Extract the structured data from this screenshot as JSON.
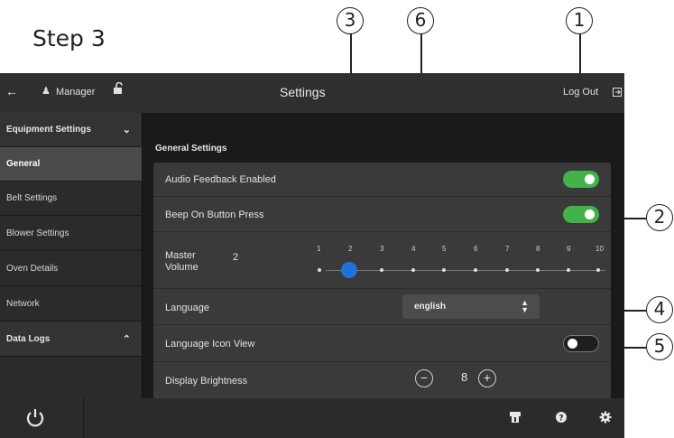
{
  "step": {
    "title": "Step 3"
  },
  "callouts": [
    "1",
    "2",
    "3",
    "4",
    "5",
    "6"
  ],
  "topbar": {
    "back_icon": "arrow-left-icon",
    "user_icon": "person-icon",
    "user_label": "Manager",
    "lock_icon": "unlock-icon",
    "title": "Settings",
    "logout_label": "Log Out",
    "logout_icon": "logout-icon"
  },
  "sidebar": {
    "items": [
      {
        "label": "Equipment Settings",
        "type": "group",
        "chevron": "˅"
      },
      {
        "label": "General",
        "type": "active"
      },
      {
        "label": "Belt Settings",
        "type": "item"
      },
      {
        "label": "Blower Settings",
        "type": "item"
      },
      {
        "label": "Oven Details",
        "type": "item"
      },
      {
        "label": "Network",
        "type": "item"
      },
      {
        "label": "Data Logs",
        "type": "group",
        "chevron": "˄"
      }
    ]
  },
  "content": {
    "section_title": "General Settings",
    "audio_feedback": {
      "label": "Audio Feedback Enabled",
      "on": true
    },
    "beep_on_press": {
      "label": "Beep On Button Press",
      "on": true
    },
    "master_volume": {
      "label_line1": "Master",
      "label_line2": "Volume",
      "value": "2",
      "ticks": [
        "1",
        "2",
        "3",
        "4",
        "5",
        "6",
        "7",
        "8",
        "9",
        "10"
      ],
      "level": 2
    },
    "language": {
      "label": "Language",
      "value": "english",
      "arrows": "⌃⌄"
    },
    "language_icon_view": {
      "label": "Language Icon View",
      "on": false
    },
    "display_brightness": {
      "label": "Display Brightness",
      "value": "8",
      "minus": "−",
      "plus": "+"
    }
  },
  "bottombar": {
    "power_icon": "power-icon",
    "icons": [
      "clean-icon",
      "help-icon",
      "gear-icon"
    ]
  },
  "colors": {
    "toggle_on": "#41b34a",
    "slider_thumb": "#1f73d8",
    "screen_bg": "#1e1e1e"
  }
}
